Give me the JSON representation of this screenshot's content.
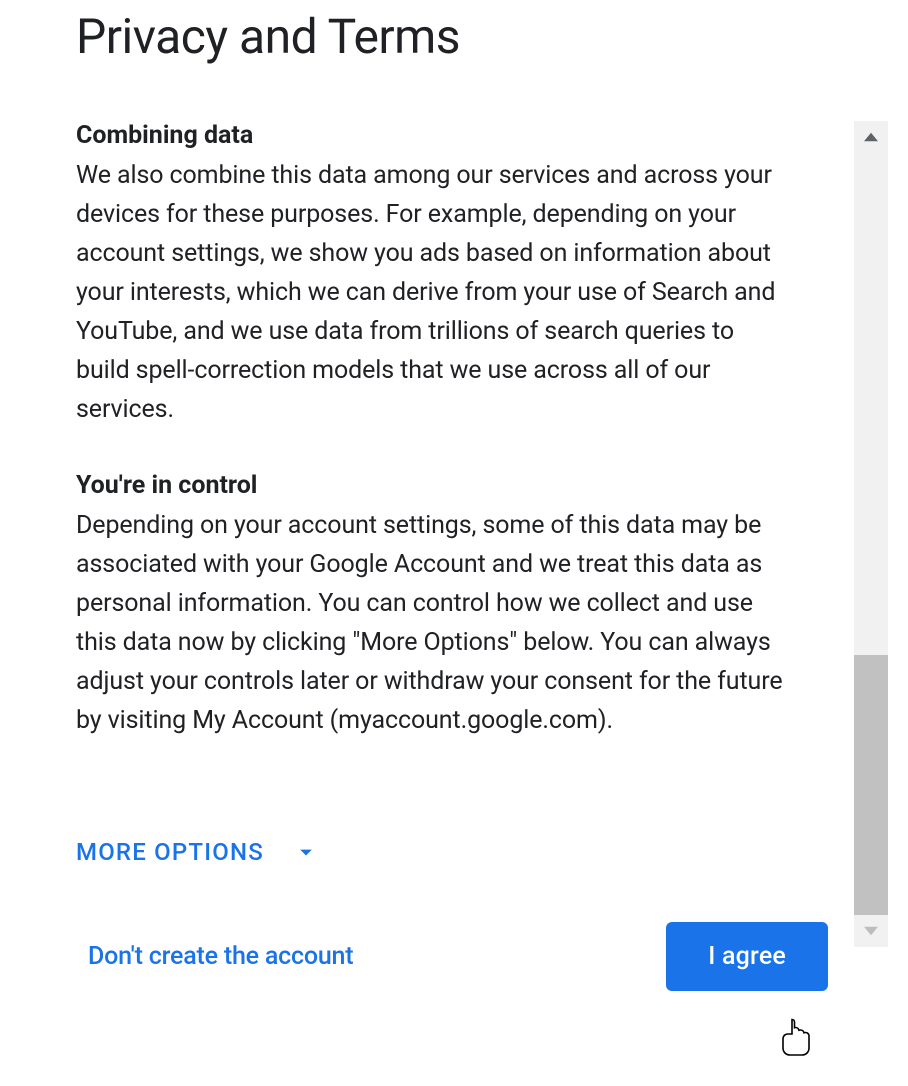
{
  "page": {
    "title": "Privacy and Terms"
  },
  "sections": [
    {
      "heading": "Combining data",
      "text": "We also combine this data among our services and across your devices for these purposes. For example, depending on your account settings, we show you ads based on information about your interests, which we can derive from your use of Search and YouTube, and we use data from trillions of search queries to build spell-correction models that we use across all of our services."
    },
    {
      "heading": "You're in control",
      "text": "Depending on your account settings, some of this data may be associated with your Google Account and we treat this data as personal information. You can control how we collect and use this data now by clicking \"More Options\" below. You can always adjust your controls later or withdraw your consent for the future by visiting My Account (myaccount.google.com)."
    }
  ],
  "actions": {
    "more_options_label": "MORE OPTIONS",
    "decline_label": "Don't create the account",
    "agree_label": "I agree"
  },
  "colors": {
    "accent": "#1a73e8",
    "text": "#202124"
  }
}
